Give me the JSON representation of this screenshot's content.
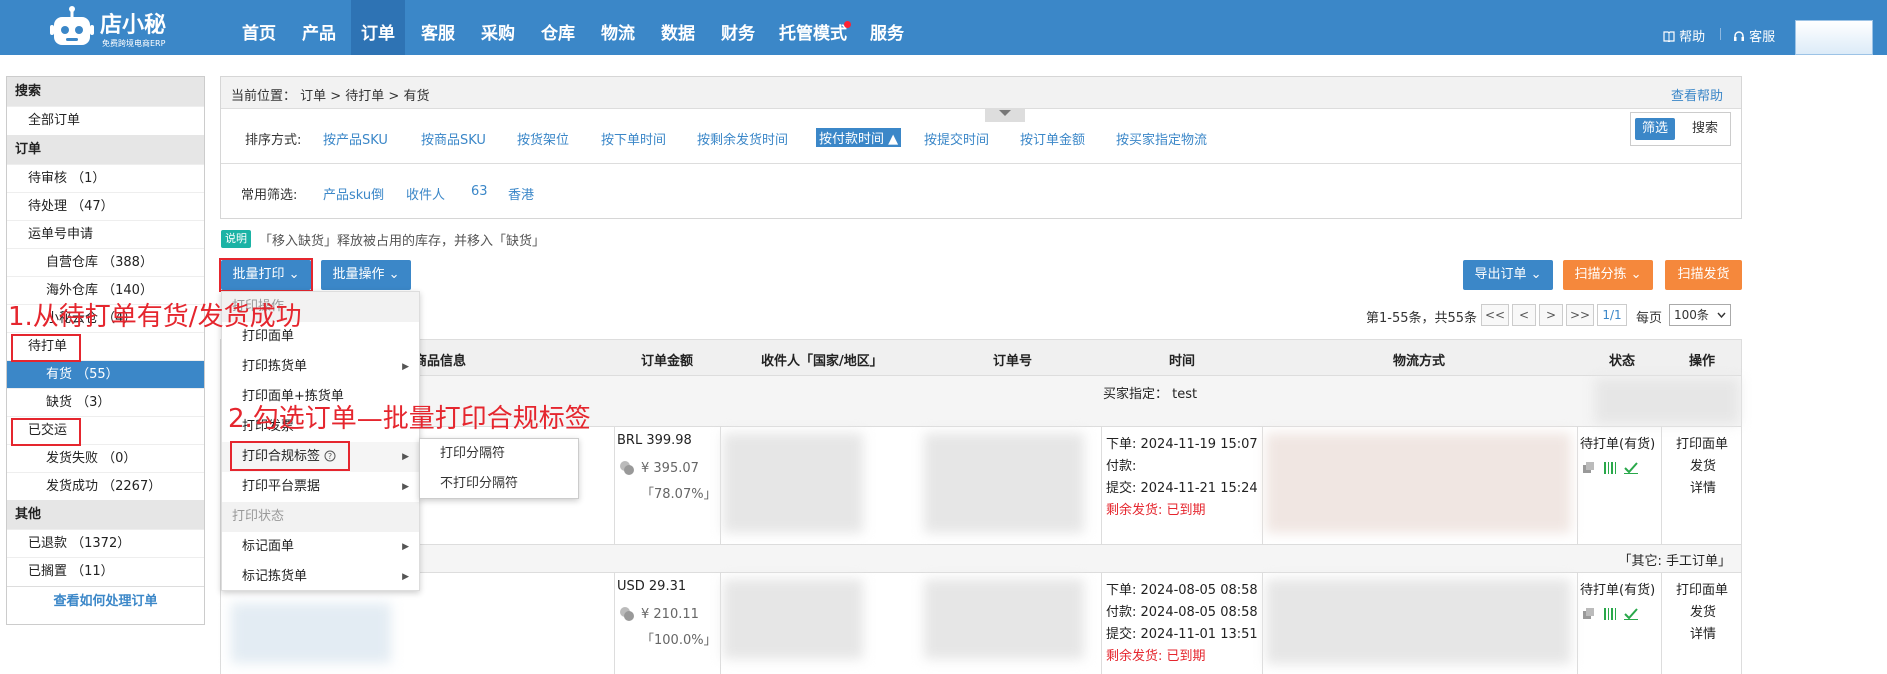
{
  "brand": {
    "name": "店小秘",
    "tagline": "免费跨境电商ERP"
  },
  "nav": [
    {
      "label": "首页",
      "active": false
    },
    {
      "label": "产品",
      "active": false
    },
    {
      "label": "订单",
      "active": true
    },
    {
      "label": "客服",
      "active": false
    },
    {
      "label": "采购",
      "active": false
    },
    {
      "label": "仓库",
      "active": false
    },
    {
      "label": "物流",
      "active": false
    },
    {
      "label": "数据",
      "active": false
    },
    {
      "label": "财务",
      "active": false
    },
    {
      "label": "托管模式",
      "active": false,
      "badge": "red-dot"
    },
    {
      "label": "服务",
      "active": false
    }
  ],
  "top_links": {
    "help": "帮助",
    "service": "客服"
  },
  "icons": {
    "help": "book-icon",
    "service": "headset-icon"
  },
  "colors": {
    "primary": "#3b87c8",
    "orange": "#f5883c",
    "annotation_red": "#e5262e",
    "accent_green": "#29a84a"
  },
  "sidebar": {
    "search": "搜索",
    "all_orders": "全部订单",
    "orders": "订单",
    "pending_review": "待审核 （1）",
    "processing": "待处理 （47）",
    "waybill": "运单号申请",
    "own_warehouse": "自营仓库 （388）",
    "overseas_warehouse": "海外仓库 （140）",
    "small_sec_warehouse": "小秘云仓 （4）",
    "to_print": "待打单",
    "in_stock": "有货 （55）",
    "out_of_stock": "缺货 （3）",
    "shipped": "已交运",
    "ship_failed": "发货失败 （0）",
    "ship_success": "发货成功 （2267）",
    "other": "其他",
    "refunded": "已退款 （1372）",
    "on_hold": "已搁置 （11）",
    "help_link": "查看如何处理订单"
  },
  "breadcrumb": "当前位置： 订单 > 待打单 > 有货",
  "help_link": "查看帮助",
  "sort": {
    "label": "排序方式:",
    "options": [
      "按产品SKU",
      "按商品SKU",
      "按货架位",
      "按下单时间",
      "按剩余发货时间",
      "按付款时间 ▲",
      "按提交时间",
      "按订单金额",
      "按买家指定物流"
    ]
  },
  "filter_toggle": {
    "filter": "筛选",
    "search": "搜索"
  },
  "common_filter": {
    "label": "常用筛选:",
    "options": [
      "产品sku倒",
      "收件人",
      "63",
      "香港"
    ]
  },
  "notice": {
    "tag": "说明",
    "text": "「移入缺货」释放被占用的库存，并移入「缺货」"
  },
  "actions": {
    "batch_print": "批量打印 ⌄",
    "batch_ops": "批量操作 ⌄",
    "export": "导出订单 ⌄",
    "scan_sort": "扫描分拣 ⌄",
    "scan_ship": "扫描发货"
  },
  "pager": {
    "summary": "第1-55条，共55条",
    "first": "<<",
    "prev": "<",
    "next": ">",
    "last": ">>",
    "page": "1/1",
    "per_page_label": "每页",
    "per_page": "100条"
  },
  "table": {
    "headers": [
      "商品信息",
      "订单金额",
      "收件人「国家/地区」",
      "订单号",
      "时间",
      "物流方式",
      "状态",
      "操作"
    ],
    "group1_note": "买家指定： test",
    "group2_note": "「其它: 手工订单」",
    "rows": [
      {
        "currency_amount": "BRL 399.98",
        "cny_amount": "¥ 395.07",
        "ratio": "「78.07%」",
        "order_time": "下单: 2024-11-19 15:07",
        "pay_time": "付款:",
        "submit_time": "提交: 2024-11-21 15:24",
        "remaining": "剩余发货: 已到期",
        "status": "待打单(有货)",
        "ops": [
          "打印面单",
          "发货",
          "详情"
        ]
      },
      {
        "currency_amount": "USD 29.31",
        "cny_amount": "¥ 210.11",
        "ratio": "「100.0%」",
        "order_time": "下单: 2024-08-05 08:58",
        "pay_time": "付款: 2024-08-05 08:58",
        "submit_time": "提交: 2024-11-01 13:51",
        "remaining": "剩余发货: 已到期",
        "status": "待打单(有货)",
        "ops": [
          "打印面单",
          "发货",
          "详情"
        ]
      }
    ]
  },
  "dropdown": {
    "header_print": "打印操作",
    "print_label": "打印面单",
    "print_pick": "打印拣货单",
    "print_label_pick": "打印面单+拣货单",
    "print_invoice": "打印发票",
    "print_compliance": "打印合规标签",
    "print_platform_invoice": "打印平台票据",
    "header_status": "打印状态",
    "mark_label": "标记面单",
    "mark_pick": "标记拣货单"
  },
  "submenu": {
    "with_sep": "打印分隔符",
    "without_sep": "不打印分隔符"
  },
  "annotations": {
    "step1": "1.从待打单有货/发货成功",
    "step2": "2.勾选订单—批量打印合规标签"
  }
}
